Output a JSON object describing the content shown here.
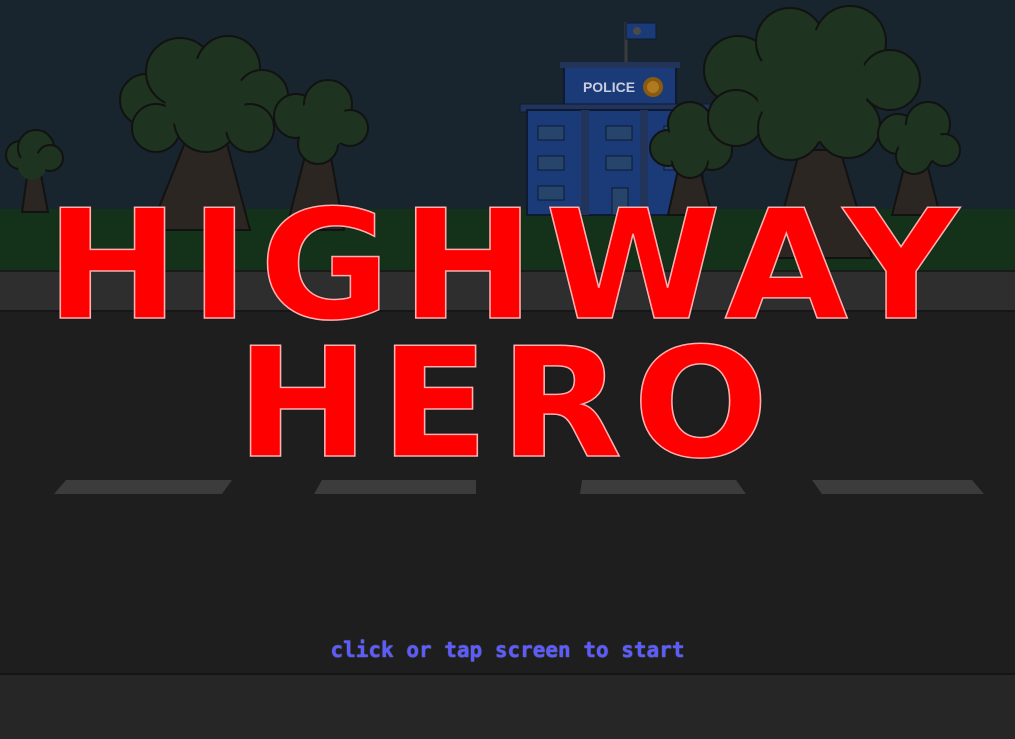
{
  "game": {
    "title_line_1": "HIGHWAY",
    "title_line_2": "HERO",
    "start_prompt": "click or tap screen to start",
    "police_sign": "POLICE"
  },
  "colors": {
    "sky": "#18252e",
    "grass": "#14321a",
    "tree_foliage": "#1e3320",
    "tree_trunk": "#2b2622",
    "sidewalk": "#2e2e2e",
    "road": "#1e1e1e",
    "lane_marking": "#3c3c3c",
    "bottom_strip": "#262626",
    "police_building": "#1b3a78",
    "title_red": "#ff0000",
    "prompt_blue": "#5b5bff"
  }
}
